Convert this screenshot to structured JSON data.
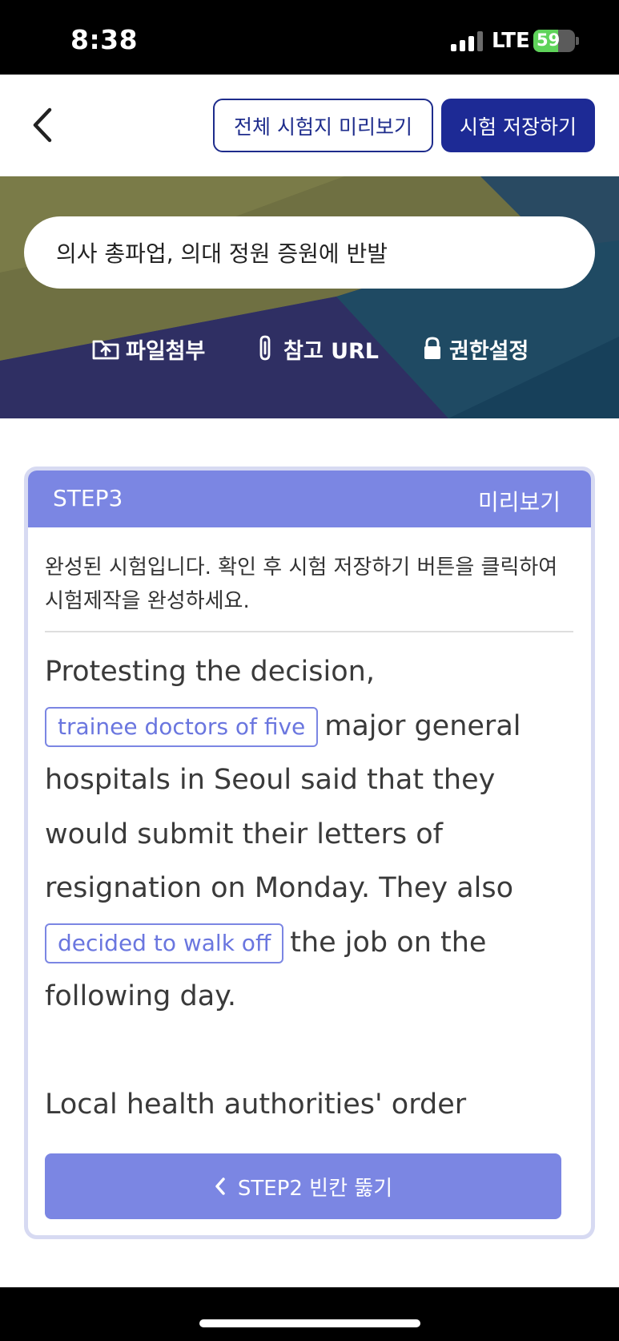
{
  "status_bar": {
    "time": "8:38",
    "network": "LTE",
    "battery_percent": 59,
    "battery_label": "59"
  },
  "nav": {
    "back_icon": "chevron-left-icon",
    "preview_all_label": "전체 시험지 미리보기",
    "save_exam_label": "시험 저장하기"
  },
  "banner": {
    "title_value": "의사 총파업, 의대 정원 증원에 반발",
    "actions": [
      {
        "icon": "folder-upload-icon",
        "label": "파일첨부"
      },
      {
        "icon": "paperclip-icon",
        "label": "참고 URL"
      },
      {
        "icon": "lock-icon",
        "label": "권한설정"
      }
    ]
  },
  "card": {
    "step_label": "STEP3",
    "preview_label": "미리보기",
    "instruction": "완성된 시험입니다. 확인 후 시험 저장하기 버튼을 클릭하여 시험제작을 완성하세요.",
    "passage": {
      "part1": "Protesting the decision,",
      "blank1": "trainee doctors of five",
      "part2": "major general hospitals in Seoul said that they would submit their letters of resignation on Monday. They also",
      "blank2": "decided to walk off",
      "part3": "the job on the following day.",
      "part4": "Local health authorities' order"
    },
    "step2_button_label": "STEP2 빈칸 뚫기"
  },
  "colors": {
    "navy": "#1d2a95",
    "accent": "#7b86e3",
    "card_border": "#d7daf2"
  }
}
